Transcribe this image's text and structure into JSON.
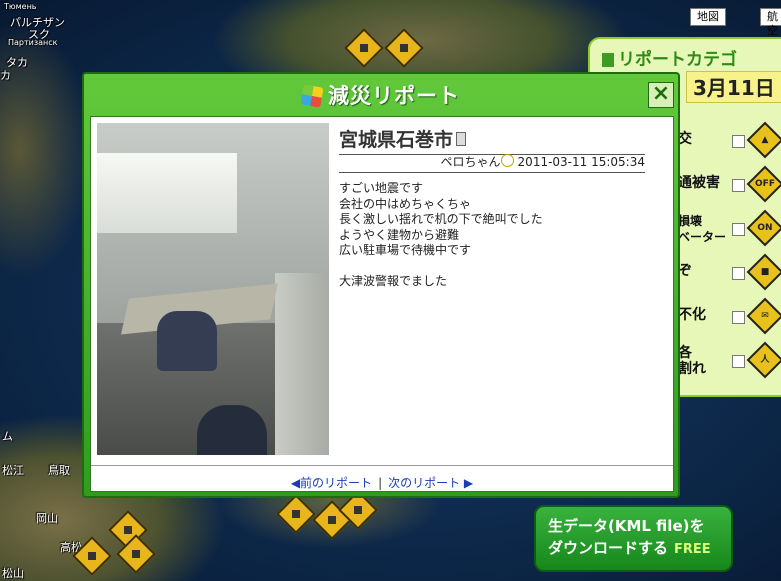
{
  "map": {
    "labels": [
      "Тюмень",
      "パルチザン",
      "スク",
      "Партизанск",
      "タカ",
      "カ",
      "松江",
      "鳥取",
      "岡山",
      "高松",
      "松山",
      "ム"
    ],
    "type_buttons": [
      "地図",
      "航空"
    ]
  },
  "category_panel": {
    "title": "リポートカテゴ",
    "date": "3月11日",
    "rows": [
      {
        "label": "交",
        "icon": "car-warning-icon"
      },
      {
        "label": "通被害",
        "icon": "power-off-icon"
      },
      {
        "label": "損壊\nベーター",
        "icon": "power-on-icon"
      },
      {
        "label": "ぞ",
        "icon": "fuel-icon"
      },
      {
        "label": "不化",
        "icon": "mobile-phone-icon"
      },
      {
        "label": "各\n割れ",
        "icon": "running-person-icon"
      }
    ]
  },
  "download_button": {
    "line1": "生データ(KML file)を",
    "line2": "ダウンロードする",
    "free": "FREE"
  },
  "dialog": {
    "title": "減災リポート",
    "close_label": "×",
    "report": {
      "location": "宮城県石巻市",
      "author": "ペロちゃん",
      "datetime": "2011-03-11 15:05:34",
      "lines": [
        "すごい地震です",
        "会社の中はめちゃくちゃ",
        "長く激しい揺れで机の下で絶叫でした",
        "ようやく建物から避難",
        "広い駐車場で待機中です",
        "",
        "大津波警報でました"
      ]
    },
    "nav": {
      "prev": "◀前のリポート",
      "separator": "|",
      "next": "次のリポート ▶"
    }
  },
  "colors": {
    "dialog_green": "#2f9c1e",
    "panel_bg": "#e6f7b8",
    "warning_yellow": "#e8b51c",
    "link_blue": "#1a3db5"
  }
}
